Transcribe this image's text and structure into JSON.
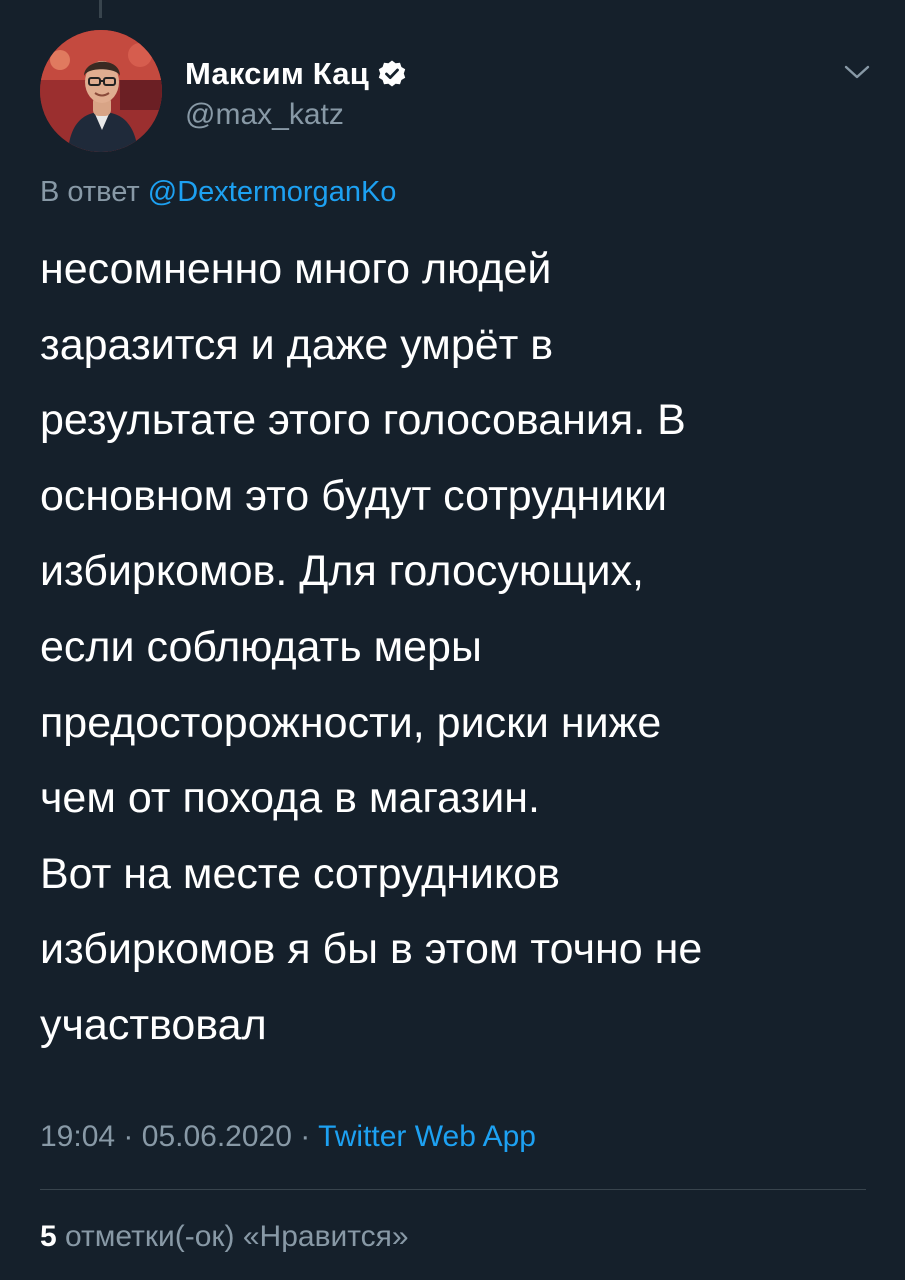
{
  "author": {
    "display_name": "Максим Кац",
    "handle": "@max_katz",
    "verified_icon": "verified-badge-icon",
    "avatar_icon": "avatar-photo"
  },
  "reply": {
    "prefix": "В ответ",
    "mention": "@DextermorganKo"
  },
  "tweet": {
    "lines": [
      "несомненно много людей",
      "заразится и даже умрёт в",
      "результате этого голосования. В",
      "основном это будут сотрудники",
      "избиркомов. Для голосующих,",
      "если соблюдать меры",
      "предосторожности, риски ниже",
      "чем от похода в магазин.",
      "Вот на месте сотрудников",
      "избиркомов я бы в этом точно не",
      "участвовал"
    ]
  },
  "meta": {
    "time": "19:04",
    "separator": "·",
    "date": "05.06.2020",
    "source": "Twitter Web App"
  },
  "stats": {
    "likes_count": "5",
    "likes_label": "отметки(-ок) «Нравится»"
  },
  "menu_icon": "chevron-down-icon",
  "colors": {
    "background": "#15202b",
    "text": "#ffffff",
    "secondary": "#8899a6",
    "accent": "#1da1f2",
    "divider": "#38444d"
  }
}
